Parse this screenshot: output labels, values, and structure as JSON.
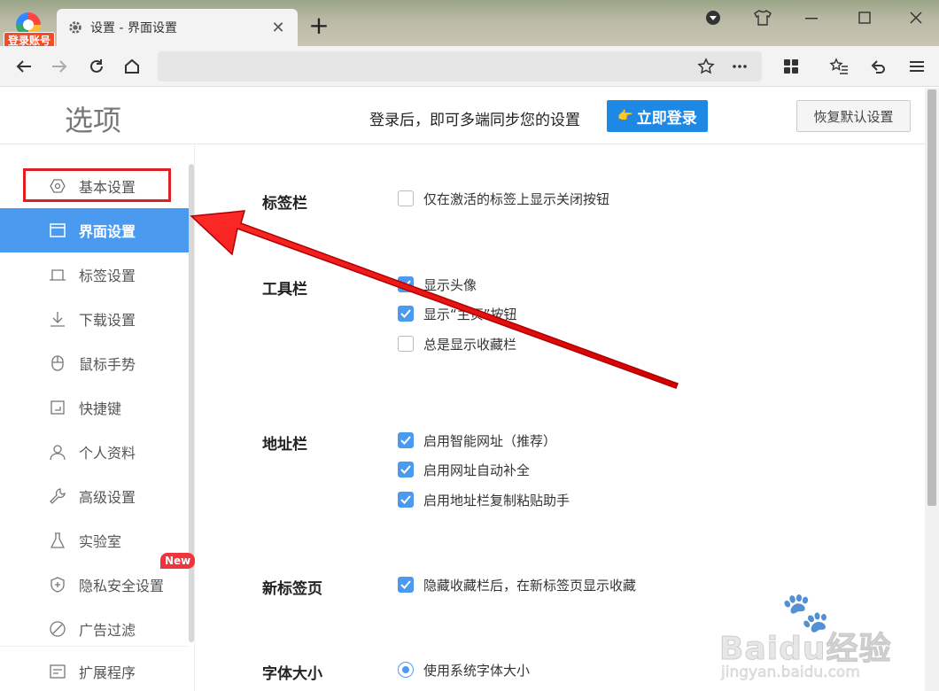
{
  "browser": {
    "login_badge": "登录账号",
    "tab_title": "设置 - 界面设置",
    "new_tab": "+",
    "omnibox_value": ""
  },
  "header": {
    "title": "选项",
    "sync_text": "登录后，即可多端同步您的设置",
    "login_button": "立即登录",
    "restore_button": "恢复默认设置"
  },
  "sidebar": {
    "items": [
      {
        "label": "基本设置",
        "icon": "hexagon-icon"
      },
      {
        "label": "界面设置",
        "icon": "window-icon"
      },
      {
        "label": "标签设置",
        "icon": "tab-icon"
      },
      {
        "label": "下载设置",
        "icon": "download-icon"
      },
      {
        "label": "鼠标手势",
        "icon": "mouse-icon"
      },
      {
        "label": "快捷键",
        "icon": "keyboard-icon"
      },
      {
        "label": "个人资料",
        "icon": "user-icon"
      },
      {
        "label": "高级设置",
        "icon": "wrench-icon"
      },
      {
        "label": "实验室",
        "icon": "flask-icon"
      },
      {
        "label": "隐私安全设置",
        "icon": "shield-icon"
      },
      {
        "label": "广告过滤",
        "icon": "block-icon"
      },
      {
        "label": "扩展程序",
        "icon": "extension-icon"
      }
    ],
    "active_index": 1,
    "new_badge": "New"
  },
  "sections": {
    "tabbar": {
      "title": "标签栏",
      "options": [
        {
          "label": "仅在激活的标签上显示关闭按钮",
          "checked": false
        }
      ]
    },
    "toolbar": {
      "title": "工具栏",
      "options": [
        {
          "label": "显示头像",
          "checked": true
        },
        {
          "label": "显示“主页”按钮",
          "checked": true
        },
        {
          "label": "总是显示收藏栏",
          "checked": false
        }
      ]
    },
    "addressbar": {
      "title": "地址栏",
      "options": [
        {
          "label": "启用智能网址（推荐）",
          "checked": true
        },
        {
          "label": "启用网址自动补全",
          "checked": true
        },
        {
          "label": "启用地址栏复制粘贴助手",
          "checked": true
        }
      ]
    },
    "newtab": {
      "title": "新标签页",
      "options": [
        {
          "label": "隐藏收藏栏后，在新标签页显示收藏",
          "checked": true
        }
      ]
    },
    "fontsize": {
      "title": "字体大小",
      "options": [
        {
          "label": "使用系统字体大小",
          "selected": true
        }
      ]
    }
  },
  "watermark": {
    "logo": "Baidu经验",
    "url": "jingyan.baidu.com"
  },
  "colors": {
    "accent": "#4a9bf0",
    "login_button": "#1e88e5",
    "annotation_red": "#e02020"
  }
}
